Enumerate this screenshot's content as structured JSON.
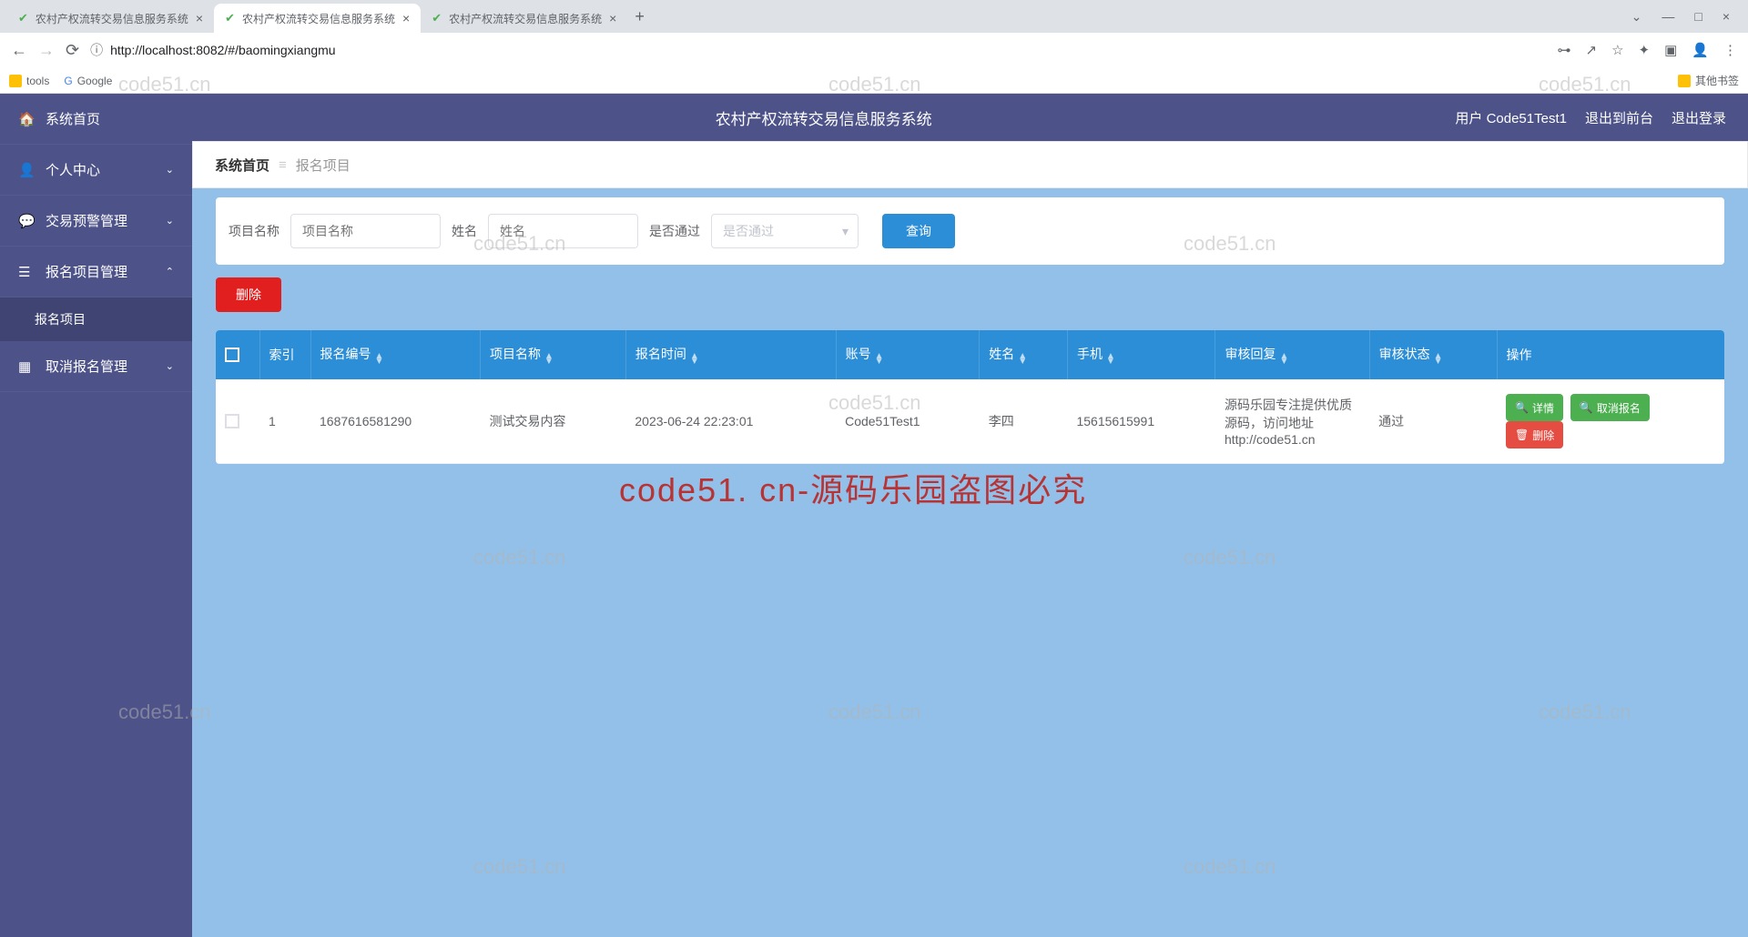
{
  "browser": {
    "tabs": [
      {
        "title": "农村产权流转交易信息服务系统"
      },
      {
        "title": "农村产权流转交易信息服务系统"
      },
      {
        "title": "农村产权流转交易信息服务系统"
      }
    ],
    "url": "http://localhost:8082/#/baomingxiangmu",
    "bookmarks": {
      "tools": "tools",
      "google": "Google",
      "other": "其他书签"
    }
  },
  "app": {
    "title": "农村产权流转交易信息服务系统",
    "user_prefix": "用户",
    "user": "Code51Test1",
    "logout_front": "退出到前台",
    "logout": "退出登录"
  },
  "sidebar": [
    {
      "icon": "🏠",
      "label": "系统首页",
      "arrow": ""
    },
    {
      "icon": "👤",
      "label": "个人中心",
      "arrow": "⌄"
    },
    {
      "icon": "💬",
      "label": "交易预警管理",
      "arrow": "⌄"
    },
    {
      "icon": "☰",
      "label": "报名项目管理",
      "arrow": "⌃",
      "expanded": true
    },
    {
      "icon": "▦",
      "label": "取消报名管理",
      "arrow": "⌄"
    }
  ],
  "sidebar_sub": "报名项目",
  "breadcrumb": {
    "home": "系统首页",
    "page": "报名项目"
  },
  "filter": {
    "project_label": "项目名称",
    "project_ph": "项目名称",
    "name_label": "姓名",
    "name_ph": "姓名",
    "pass_label": "是否通过",
    "pass_ph": "是否通过",
    "query_btn": "查询"
  },
  "delete_btn": "删除",
  "table": {
    "headers": [
      "",
      "索引",
      "报名编号",
      "项目名称",
      "报名时间",
      "账号",
      "姓名",
      "手机",
      "审核回复",
      "审核状态",
      "操作"
    ],
    "rows": [
      {
        "index": "1",
        "reg_no": "1687616581290",
        "project": "测试交易内容",
        "time": "2023-06-24 22:23:01",
        "account": "Code51Test1",
        "name": "李四",
        "phone": "15615615991",
        "reply": "源码乐园专注提供优质源码，访问地址http://code51.cn",
        "status": "通过"
      }
    ],
    "actions": {
      "detail": "详情",
      "cancel": "取消报名",
      "delete": "删除"
    }
  },
  "watermark": "code51.cn",
  "watermark_red": "code51. cn-源码乐园盗图必究"
}
